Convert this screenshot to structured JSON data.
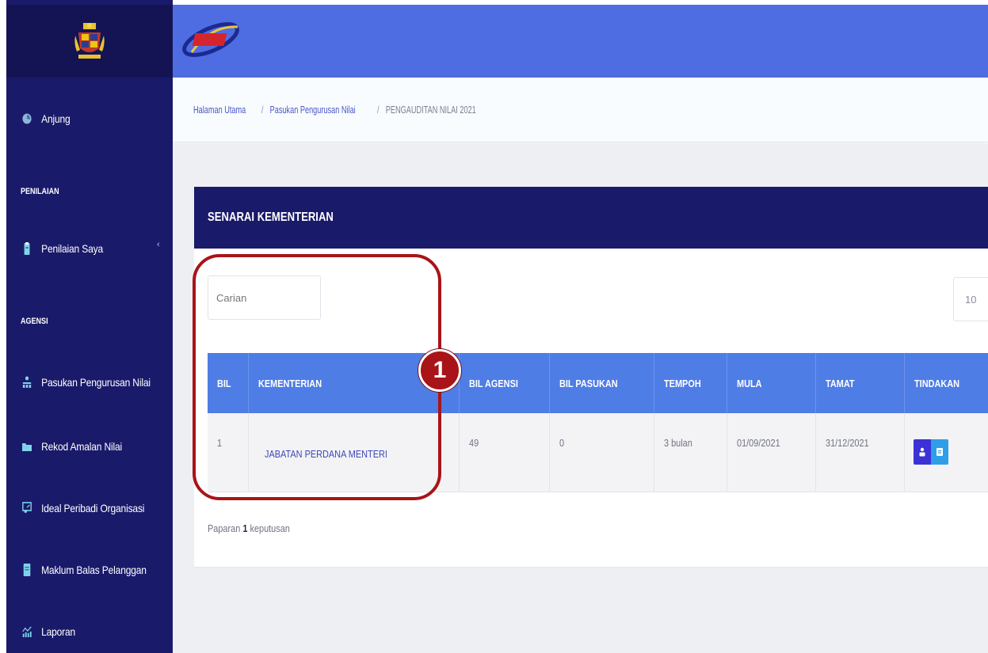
{
  "sidebar": {
    "items": [
      {
        "label": "Anjung",
        "icon": "dashboard-icon"
      },
      {
        "label": "Penilaian Saya",
        "icon": "clipboard-icon"
      },
      {
        "label": "Pasukan Pengurusan Nilai",
        "icon": "team-icon"
      },
      {
        "label": "Rekod Amalan Nilai",
        "icon": "folder-icon"
      },
      {
        "label": "Ideal Peribadi Organisasi",
        "icon": "presentation-icon"
      },
      {
        "label": "Maklum Balas Pelanggan",
        "icon": "book-icon"
      },
      {
        "label": "Laporan",
        "icon": "report-chart-icon"
      }
    ],
    "headers": {
      "penilaian": "PENILAIAN",
      "agensi": "AGENSI"
    },
    "chevron": "‹"
  },
  "topbar": {
    "logo_icon": "nsam-logo-icon"
  },
  "breadcrumb": {
    "home": "Halaman Utama",
    "parent": "Pasukan Pengurusan Nilai",
    "current": "PENGAUDITAN NILAI 2021",
    "separator": "/"
  },
  "card": {
    "title": "SENARAI KEMENTERIAN"
  },
  "search": {
    "placeholder": "Carian"
  },
  "pagesize": {
    "value": "10"
  },
  "table": {
    "columns": [
      "BIL",
      "KEMENTERIAN",
      "BIL AGENSI",
      "BIL PASUKAN",
      "TEMPOH",
      "MULA",
      "TAMAT",
      "TINDAKAN"
    ],
    "rows": [
      {
        "bil": "1",
        "kementerian": "JABATAN PERDANA MENTERI",
        "bil_agensi": "49",
        "bil_pasukan": "0",
        "tempoh": "3 bulan",
        "mula": "01/09/2021",
        "tamat": "31/12/2021"
      }
    ]
  },
  "summary": {
    "prefix": "Paparan",
    "count": "1",
    "suffix": "keputusan"
  },
  "annotation": {
    "number": "1"
  },
  "colors": {
    "sidebar": "#1a1a6b",
    "topbar": "#4f6de2",
    "table_header": "#4f7de6",
    "annotation": "#a81418"
  }
}
